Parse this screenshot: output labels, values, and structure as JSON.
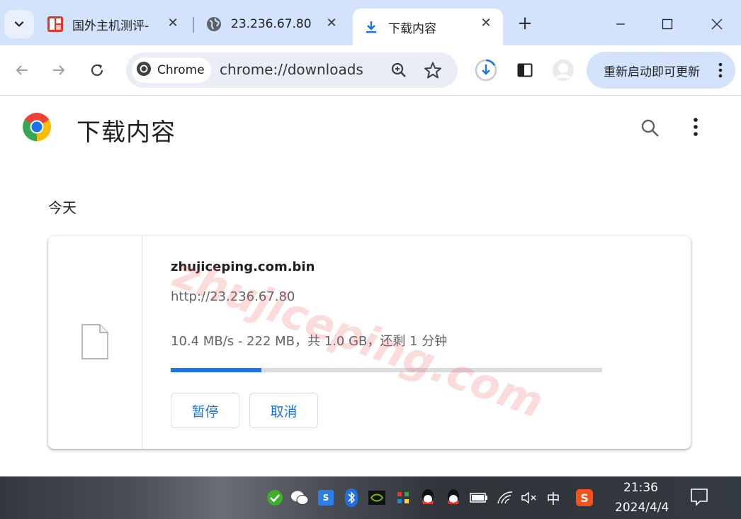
{
  "tabs": [
    {
      "title": "国外主机测评-",
      "active": false,
      "favicon": "site-favicon-red"
    },
    {
      "title": "23.236.67.80",
      "active": false,
      "favicon": "globe-icon"
    },
    {
      "title": "下载内容",
      "active": true,
      "favicon": "download-icon"
    }
  ],
  "toolbar": {
    "chip_label": "Chrome",
    "url": "chrome://downloads",
    "update_label": "重新启动即可更新"
  },
  "page": {
    "title": "下载内容",
    "section_label": "今天"
  },
  "download": {
    "filename": "zhujiceping.com.bin",
    "source_url": "http://23.236.67.80",
    "status": "10.4 MB/s - 222 MB，共 1.0 GB，还剩 1 分钟",
    "progress_fraction": 0.21,
    "pause_label": "暂停",
    "cancel_label": "取消"
  },
  "watermark": "zhujiceping.com",
  "taskbar": {
    "ime_label": "中",
    "time": "21:36",
    "date": "2024/4/4"
  },
  "colors": {
    "accent": "#1a73e8",
    "tabstrip": "#d3e3fd",
    "omnibox": "#e9eef6"
  }
}
